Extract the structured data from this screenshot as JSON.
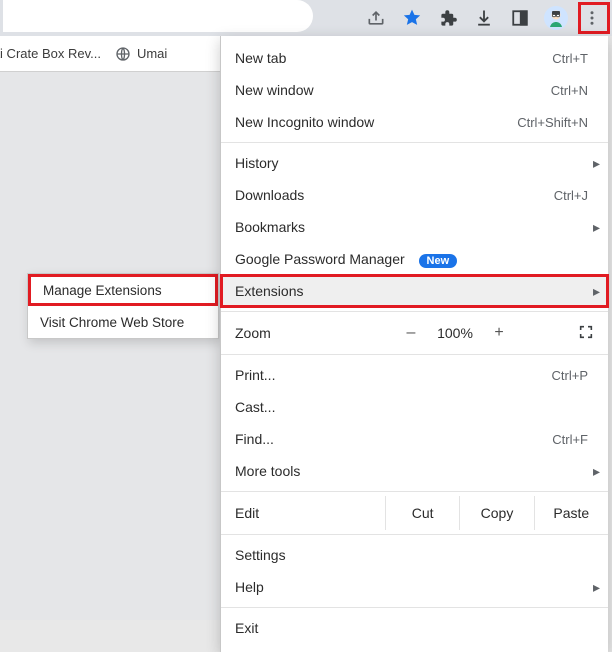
{
  "toolbar": {
    "share_icon": "share-icon",
    "bookmark_icon": "bookmark-star-icon",
    "extensions_icon": "extensions-puzzle-icon",
    "download_icon": "download-icon",
    "sidepanel_icon": "side-panel-icon",
    "avatar_icon": "avatar-icon",
    "kebab_icon": "kebab-menu-icon"
  },
  "bookmarks_bar": {
    "item1": {
      "label": "mai Crate Box Rev..."
    },
    "item2": {
      "label": "Umai"
    }
  },
  "submenu": {
    "items": [
      {
        "label": "Manage Extensions",
        "hl": true
      },
      {
        "label": "Visit Chrome Web Store",
        "hl": false
      }
    ]
  },
  "menu": {
    "new_tab": {
      "label": "New tab",
      "shortcut": "Ctrl+T"
    },
    "new_window": {
      "label": "New window",
      "shortcut": "Ctrl+N"
    },
    "new_incognito": {
      "label": "New Incognito window",
      "shortcut": "Ctrl+Shift+N"
    },
    "history": {
      "label": "History"
    },
    "downloads": {
      "label": "Downloads",
      "shortcut": "Ctrl+J"
    },
    "bookmarks": {
      "label": "Bookmarks"
    },
    "pwd_mgr": {
      "label": "Google Password Manager",
      "badge": "New"
    },
    "extensions": {
      "label": "Extensions"
    },
    "zoom": {
      "label": "Zoom",
      "minus": "–",
      "pct": "100%",
      "plus": "+"
    },
    "print": {
      "label": "Print...",
      "shortcut": "Ctrl+P"
    },
    "cast": {
      "label": "Cast..."
    },
    "find": {
      "label": "Find...",
      "shortcut": "Ctrl+F"
    },
    "more_tools": {
      "label": "More tools"
    },
    "edit": {
      "label": "Edit",
      "cut": "Cut",
      "copy": "Copy",
      "paste": "Paste"
    },
    "settings": {
      "label": "Settings"
    },
    "help": {
      "label": "Help"
    },
    "exit": {
      "label": "Exit"
    }
  }
}
